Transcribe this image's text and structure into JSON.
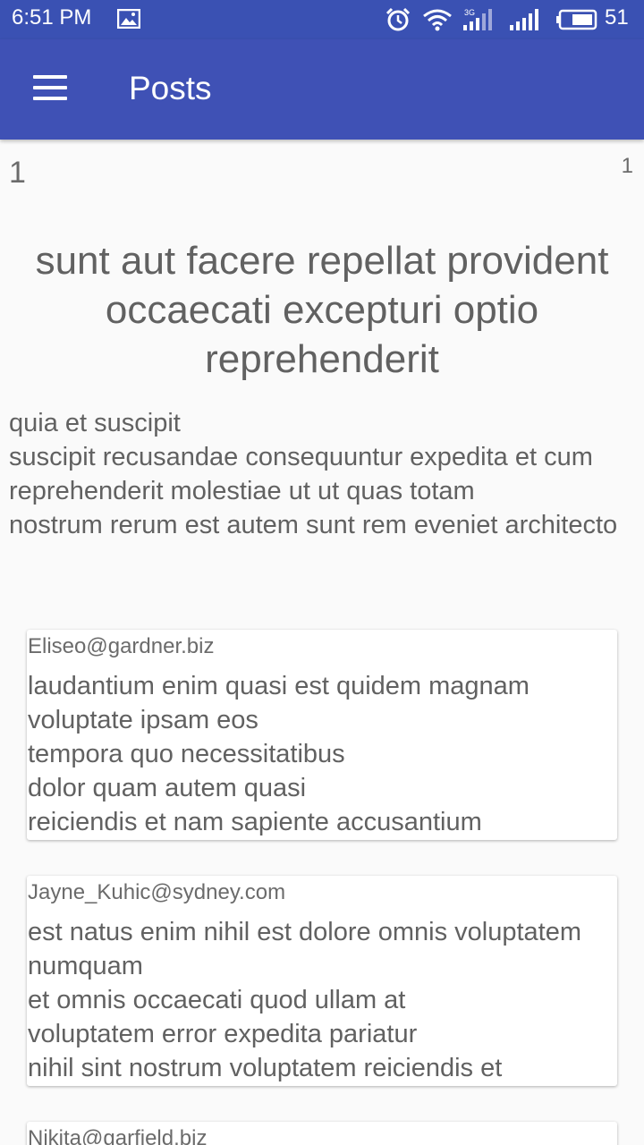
{
  "status_bar": {
    "time": "6:51 PM",
    "battery_percent": "51",
    "network_badge": "3G",
    "icons": [
      "gallery-icon",
      "alarm-icon",
      "wifi-icon",
      "signal-icon",
      "signal-icon",
      "battery-icon"
    ]
  },
  "app_bar": {
    "title": "Posts",
    "menu_icon": "hamburger-menu-icon",
    "color": "#3f51b5"
  },
  "post": {
    "id": "1",
    "user_id": "1",
    "title": "sunt aut facere repellat provident occaecati excepturi optio reprehenderit",
    "body": "quia et suscipit\nsuscipit recusandae consequuntur expedita et cum\nreprehenderit molestiae ut ut quas totam\nnostrum rerum est autem sunt rem eveniet architecto"
  },
  "comments": [
    {
      "email": "Eliseo@gardner.biz",
      "body": "laudantium enim quasi est quidem magnam voluptate ipsam eos\ntempora quo necessitatibus\ndolor quam autem quasi\nreiciendis et nam sapiente accusantium"
    },
    {
      "email": "Jayne_Kuhic@sydney.com",
      "body": "est natus enim nihil est dolore omnis voluptatem numquam\net omnis occaecati quod ullam at\nvoluptatem error expedita pariatur\nnihil sint nostrum voluptatem reiciendis et"
    },
    {
      "email": "Nikita@garfield.biz",
      "body": ""
    }
  ]
}
